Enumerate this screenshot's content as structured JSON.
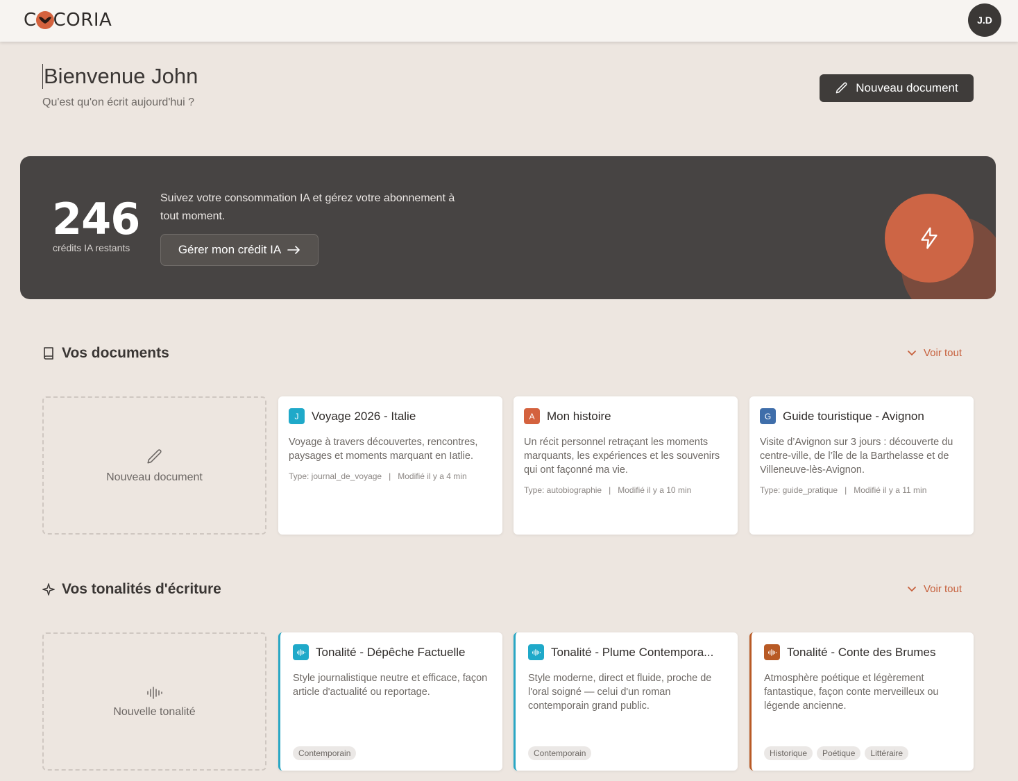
{
  "brand": {
    "logo_left": "C",
    "logo_right": "CORIA"
  },
  "user": {
    "initials": "J.D"
  },
  "welcome": {
    "title": "Bienvenue John",
    "subtitle": "Qu'est qu'on écrit aujourd'hui ?",
    "new_doc_label": "Nouveau document"
  },
  "credits": {
    "count": "246",
    "count_label": "crédits IA restants",
    "description": "Suivez votre consommation IA et gérez votre abonnement à tout moment.",
    "manage_label": "Gérer mon crédit IA",
    "colors": {
      "panel": "#474443",
      "accent": "#cd6545"
    }
  },
  "documents": {
    "title": "Vos documents",
    "see_all": "Voir tout",
    "new_label": "Nouveau document",
    "items": [
      {
        "badge": "J",
        "badge_color": "#1fa9c9",
        "title": "Voyage 2026 - Italie",
        "description": "Voyage à travers découvertes, rencontres, paysages et moments marquant en Iatlie.",
        "type": "Type: journal_de_voyage",
        "modified": "Modifié il y a 4 min"
      },
      {
        "badge": "A",
        "badge_color": "#d4623e",
        "title": "Mon histoire",
        "description": "Un récit personnel retraçant les moments marquants, les expériences et les souvenirs qui ont façonné ma vie.",
        "type": "Type: autobiographie",
        "modified": "Modifié il y a 10 min"
      },
      {
        "badge": "G",
        "badge_color": "#3f6eaa",
        "title": "Guide touristique - Avignon",
        "description": "Visite d’Avignon sur 3 jours : découverte du centre-ville, de l’île de la Barthelasse et de Villeneuve-lès-Avignon.",
        "type": "Type: guide_pratique",
        "modified": "Modifié il y a 11 min"
      }
    ]
  },
  "tones": {
    "title": "Vos tonalités d'écriture",
    "see_all": "Voir tout",
    "new_label": "Nouvelle tonalité",
    "items": [
      {
        "title": "Tonalité - Dépêche Factuelle",
        "description": "Style journalistique neutre et efficace, façon article d'actualité ou reportage.",
        "tags": [
          "Contemporain"
        ],
        "color": "#1fa9c9"
      },
      {
        "title": "Tonalité - Plume Contempora...",
        "description": "Style moderne, direct et fluide, proche de l'oral soigné — celui d'un roman contemporain grand public.",
        "tags": [
          "Contemporain"
        ],
        "color": "#1fa9c9"
      },
      {
        "title": "Tonalité - Conte des Brumes",
        "description": "Atmosphère poétique et légèrement fantastique, façon conte merveilleux ou légende ancienne.",
        "tags": [
          "Historique",
          "Poétique",
          "Littéraire"
        ],
        "color": "#b85a25"
      }
    ]
  },
  "icons": [
    "logo-mark-icon",
    "pencil-icon",
    "lightning-icon",
    "book-icon",
    "sparkle-icon",
    "chevron-down-icon",
    "arrow-right-icon",
    "waveform-icon"
  ]
}
